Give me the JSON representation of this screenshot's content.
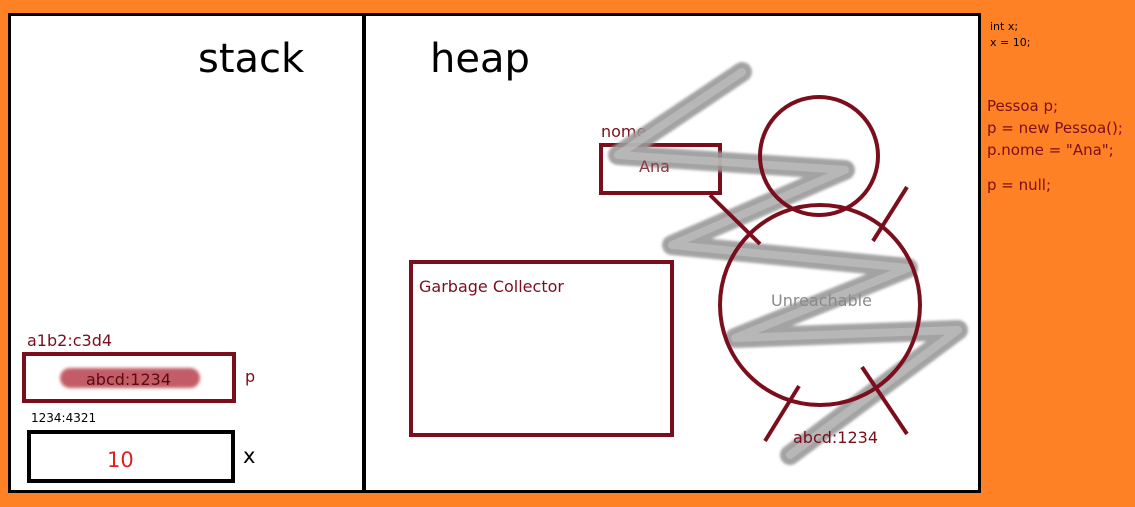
{
  "stack": {
    "title": "stack",
    "p_address": "a1b2:c3d4",
    "p_value": "abcd:1234",
    "p_label": "p",
    "x_address": "1234:4321",
    "x_value": "10",
    "x_label": "x"
  },
  "heap": {
    "title": "heap",
    "field_name": "nome",
    "field_value": "Ana",
    "gc_label": "Garbage Collector",
    "unreachable_label": "Unreachable",
    "object_address": "abcd:1234"
  },
  "code": {
    "block1": [
      "int x;",
      "x = 10;"
    ],
    "block2": [
      "Pessoa p;",
      "p = new Pessoa();",
      "p.nome = \"Ana\";"
    ],
    "block3": [
      "p = null;"
    ]
  },
  "colors": {
    "background": "#ff8125",
    "accent": "#7a0e1c",
    "value_red": "#e02020",
    "scribble": "#9a9a9a"
  }
}
